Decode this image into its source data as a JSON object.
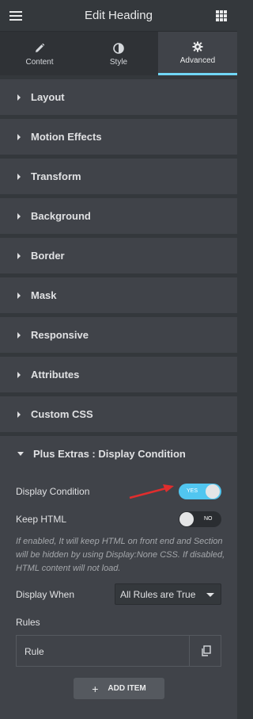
{
  "header": {
    "title": "Edit Heading"
  },
  "tabs": [
    {
      "label": "Content",
      "icon": "pencil-icon"
    },
    {
      "label": "Style",
      "icon": "half-circle-icon"
    },
    {
      "label": "Advanced",
      "icon": "gear-icon",
      "active": true
    }
  ],
  "sections": [
    {
      "label": "Layout"
    },
    {
      "label": "Motion Effects"
    },
    {
      "label": "Transform"
    },
    {
      "label": "Background"
    },
    {
      "label": "Border"
    },
    {
      "label": "Mask"
    },
    {
      "label": "Responsive"
    },
    {
      "label": "Attributes"
    },
    {
      "label": "Custom CSS"
    },
    {
      "label": "Plus Extras : Display Condition"
    }
  ],
  "panel": {
    "display_condition_label": "Display Condition",
    "display_condition_toggle": "YES",
    "keep_html_label": "Keep HTML",
    "keep_html_toggle": "NO",
    "note": "If enabled, It will keep HTML on front end and Section will be hidden by using Display:None CSS. If disabled, HTML content will not load.",
    "display_when_label": "Display When",
    "display_when_value": "All Rules are True",
    "rules_label": "Rules",
    "rule_item": "Rule",
    "add_item_label": "ADD ITEM"
  },
  "colors": {
    "accent": "#71d7f7",
    "toggle_on": "#51c6f0",
    "arrow": "#e02d2d"
  }
}
